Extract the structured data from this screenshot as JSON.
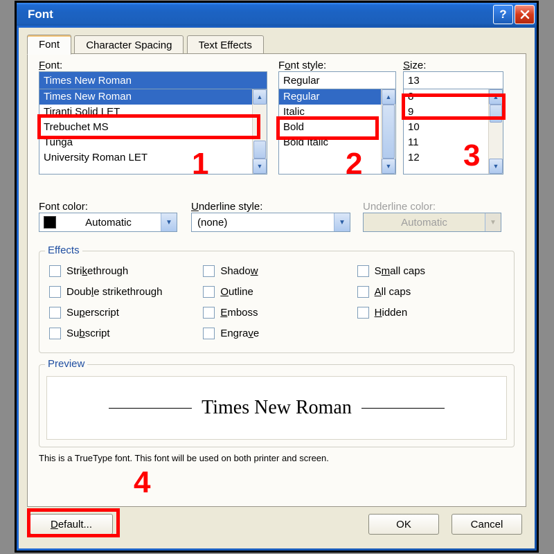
{
  "dialog": {
    "title": "Font",
    "tabs": [
      "Font",
      "Character Spacing",
      "Text Effects"
    ],
    "active_tab": 0,
    "labels": {
      "font": "Font:",
      "style": "Font style:",
      "size": "Size:",
      "font_color": "Font color:",
      "underline_style": "Underline style:",
      "underline_color": "Underline color:"
    },
    "inputs": {
      "font": "Times New Roman",
      "style": "Regular",
      "size": "13"
    },
    "font_list": [
      "Times New Roman",
      "Tiranti Solid LET",
      "Trebuchet MS",
      "Tunga",
      "University Roman LET"
    ],
    "font_list_selected": 0,
    "style_list": [
      "Regular",
      "Italic",
      "Bold",
      "Bold Italic"
    ],
    "style_list_selected": 0,
    "size_list": [
      "8",
      "9",
      "10",
      "11",
      "12"
    ],
    "size_list_selected": null,
    "font_color": "Automatic",
    "underline_style": "(none)",
    "underline_color": "Automatic",
    "effects_legend": "Effects",
    "effects": {
      "strike": "Strikethrough",
      "dstrike": "Double strikethrough",
      "super": "Superscript",
      "sub": "Subscript",
      "shadow": "Shadow",
      "outline": "Outline",
      "emboss": "Emboss",
      "engrave": "Engrave",
      "smallcaps": "Small caps",
      "allcaps": "All caps",
      "hidden": "Hidden"
    },
    "preview_legend": "Preview",
    "preview_text": "Times New Roman",
    "hint": "This is a TrueType font. This font will be used on both printer and screen.",
    "buttons": {
      "default": "Default...",
      "ok": "OK",
      "cancel": "Cancel"
    }
  },
  "annotations": {
    "n1": "1",
    "n2": "2",
    "n3": "3",
    "n4": "4"
  }
}
